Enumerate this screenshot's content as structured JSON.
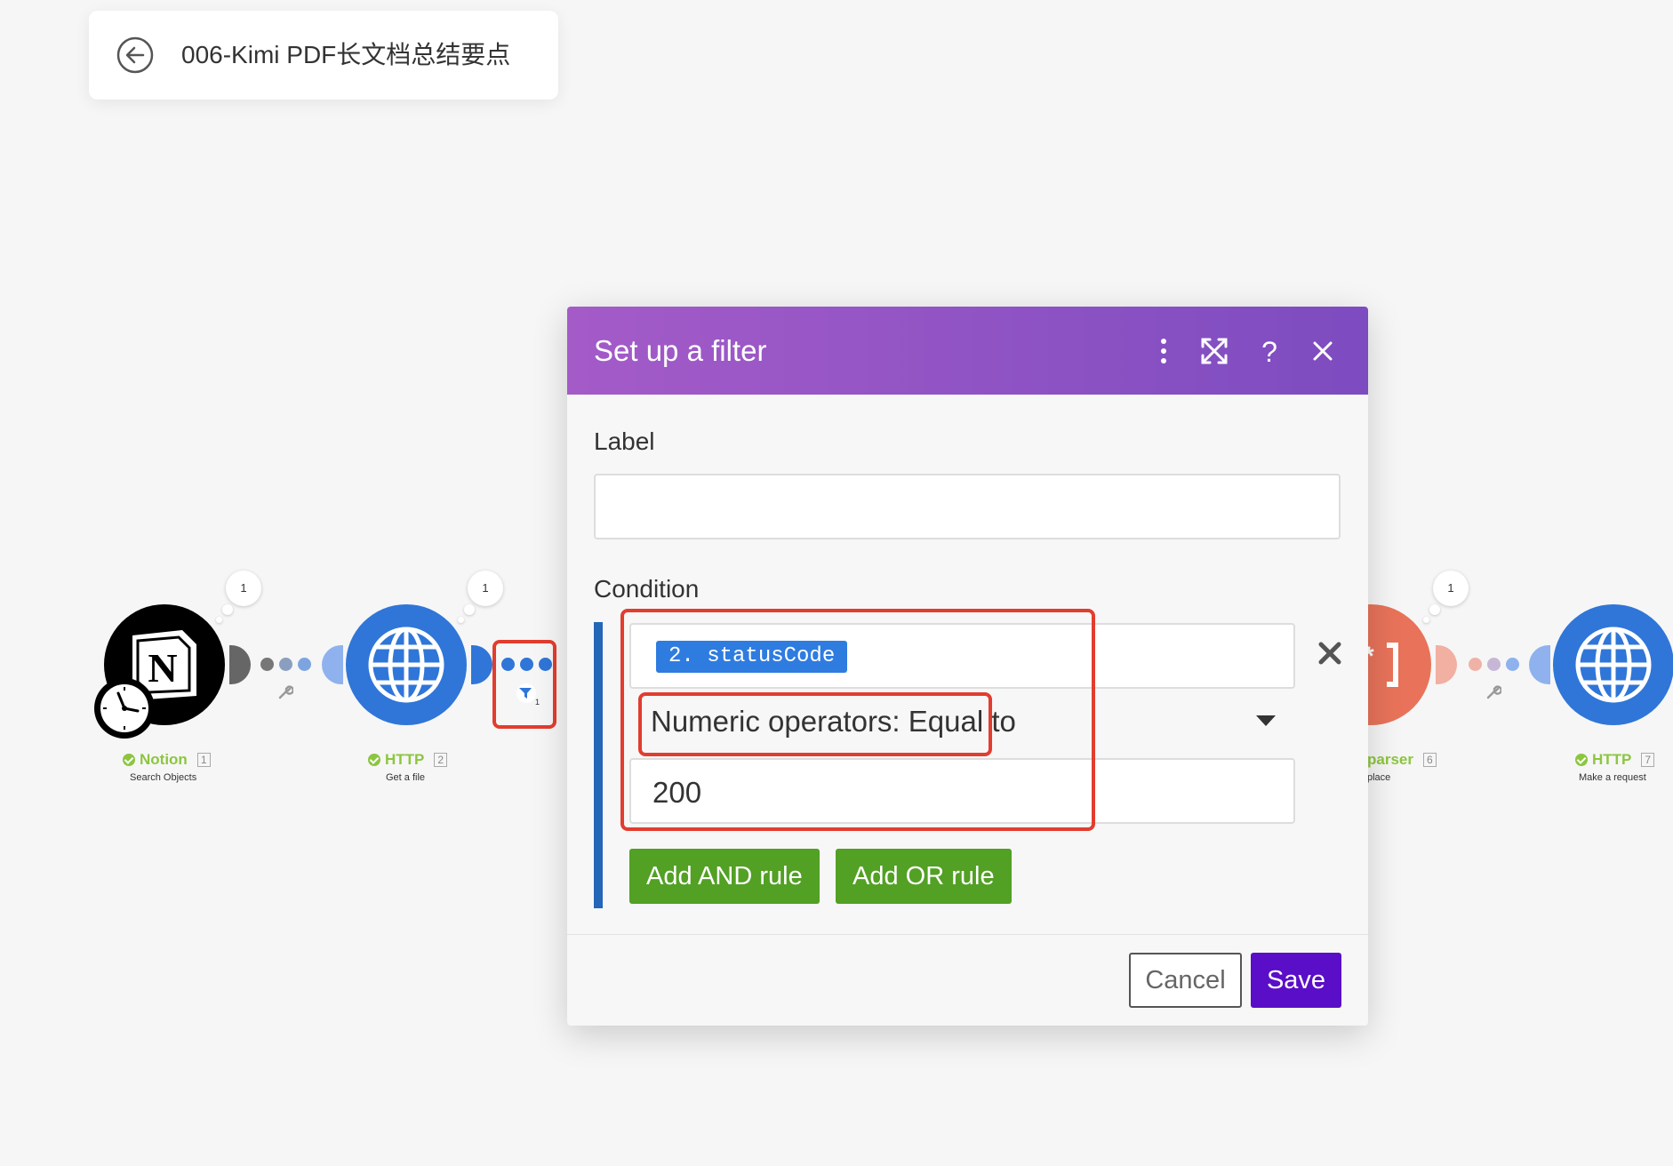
{
  "scenario": {
    "title": "006-Kimi PDF长文档总结要点"
  },
  "flow": {
    "modules": [
      {
        "name": "Notion",
        "index": "1",
        "subtitle": "Search Objects",
        "bubble": "1",
        "icon": "notion-icon"
      },
      {
        "name": "HTTP",
        "index": "2",
        "subtitle": "Get a file",
        "bubble": "1",
        "icon": "globe-icon"
      },
      {
        "name": "parser",
        "index": "6",
        "subtitle": "place",
        "bubble": "1",
        "icon": "text-parser-icon"
      },
      {
        "name": "HTTP",
        "index": "7",
        "subtitle": "Make a request",
        "icon": "globe-icon"
      }
    ],
    "filter_count": "1"
  },
  "dialog": {
    "title": "Set up a filter",
    "label_field": {
      "label": "Label",
      "value": ""
    },
    "condition": {
      "label": "Condition",
      "operand": "2. statusCode",
      "operator": "Numeric operators: Equal to",
      "value": "200"
    },
    "add_and_label": "Add AND rule",
    "add_or_label": "Add OR rule",
    "cancel_label": "Cancel",
    "save_label": "Save"
  },
  "colors": {
    "header_start": "#a45bc8",
    "header_end": "#7d4cc0",
    "save": "#5a0ec7",
    "add_rule": "#52a024",
    "operand_pill": "#2f7ce0",
    "highlight": "#e23d2e",
    "http_module": "#2f76d8",
    "parser_module": "#e8735a",
    "module_ok": "#8cc63f"
  }
}
